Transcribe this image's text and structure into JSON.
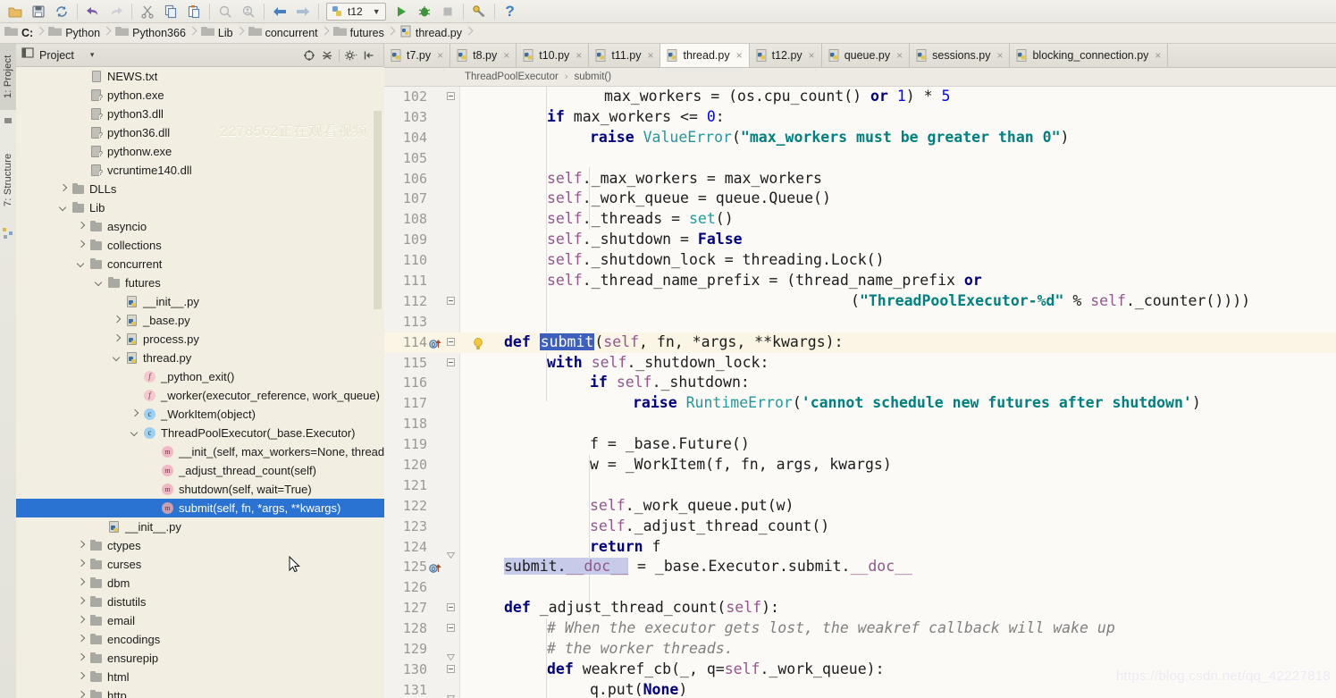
{
  "toolbar": {
    "buttons": [
      {
        "name": "open-folder-icon",
        "glyph": "folder"
      },
      {
        "name": "save-all-icon",
        "glyph": "save"
      },
      {
        "name": "sync-icon",
        "glyph": "sync"
      },
      {
        "name": "undo-icon",
        "glyph": "undo"
      },
      {
        "name": "redo-icon",
        "glyph": "redo"
      },
      {
        "name": "cut-icon",
        "glyph": "cut"
      },
      {
        "name": "copy-icon",
        "glyph": "copy"
      },
      {
        "name": "paste-icon",
        "glyph": "paste"
      },
      {
        "name": "find-icon",
        "glyph": "find"
      },
      {
        "name": "replace-icon",
        "glyph": "replace"
      },
      {
        "name": "back-icon",
        "glyph": "back"
      },
      {
        "name": "forward-icon",
        "glyph": "forward"
      }
    ],
    "run_config": {
      "label": "t12",
      "chevron": "▼"
    },
    "run_label": "Run",
    "debug_label": "Debug",
    "stop_label": "Stop",
    "tools_label": "Tools",
    "help_label": "?"
  },
  "pathbar": {
    "crumbs": [
      {
        "label": "C:",
        "icon": "folder-icon"
      },
      {
        "label": "Python",
        "icon": "folder-icon"
      },
      {
        "label": "Python366",
        "icon": "folder-icon"
      },
      {
        "label": "Lib",
        "icon": "folder-icon"
      },
      {
        "label": "concurrent",
        "icon": "folder-icon"
      },
      {
        "label": "futures",
        "icon": "folder-icon"
      },
      {
        "label": "thread.py",
        "icon": "python-file-icon"
      }
    ]
  },
  "rail": {
    "project_label": "1: Project",
    "structure_label": "7: Structure"
  },
  "project_panel": {
    "title": "Project",
    "dropdown_caret": "▾",
    "header_icons": [
      {
        "name": "locate-icon"
      },
      {
        "name": "collapse-all-icon"
      },
      {
        "name": "settings-icon"
      },
      {
        "name": "hide-panel-icon"
      }
    ],
    "watermark": "2278562正在观看视频",
    "tree": [
      {
        "label": "NEWS.txt",
        "indent": 3,
        "arrow": "none",
        "icon": "txt",
        "sel": false
      },
      {
        "label": "python.exe",
        "indent": 3,
        "arrow": "none",
        "icon": "dll",
        "sel": false
      },
      {
        "label": "python3.dll",
        "indent": 3,
        "arrow": "none",
        "icon": "dll",
        "sel": false
      },
      {
        "label": "python36.dll",
        "indent": 3,
        "arrow": "none",
        "icon": "dll",
        "sel": false
      },
      {
        "label": "pythonw.exe",
        "indent": 3,
        "arrow": "none",
        "icon": "dll",
        "sel": false
      },
      {
        "label": "vcruntime140.dll",
        "indent": 3,
        "arrow": "none",
        "icon": "dll",
        "sel": false
      },
      {
        "label": "DLLs",
        "indent": 2,
        "arrow": "closed",
        "icon": "folder",
        "sel": false
      },
      {
        "label": "Lib",
        "indent": 2,
        "arrow": "open",
        "icon": "folder",
        "sel": false
      },
      {
        "label": "asyncio",
        "indent": 3,
        "arrow": "closed",
        "icon": "folder",
        "sel": false
      },
      {
        "label": "collections",
        "indent": 3,
        "arrow": "closed",
        "icon": "folder",
        "sel": false
      },
      {
        "label": "concurrent",
        "indent": 3,
        "arrow": "open",
        "icon": "folder",
        "sel": false
      },
      {
        "label": "futures",
        "indent": 4,
        "arrow": "open",
        "icon": "folder",
        "sel": false
      },
      {
        "label": "__init__.py",
        "indent": 5,
        "arrow": "none",
        "icon": "py",
        "sel": false
      },
      {
        "label": "_base.py",
        "indent": 5,
        "arrow": "closed",
        "icon": "py",
        "sel": false
      },
      {
        "label": "process.py",
        "indent": 5,
        "arrow": "closed",
        "icon": "py",
        "sel": false
      },
      {
        "label": "thread.py",
        "indent": 5,
        "arrow": "open",
        "icon": "py",
        "sel": false
      },
      {
        "label": "_python_exit()",
        "indent": 6,
        "arrow": "none",
        "icon": "f",
        "sel": false
      },
      {
        "label": "_worker(executor_reference, work_queue)",
        "indent": 6,
        "arrow": "none",
        "icon": "f",
        "sel": false
      },
      {
        "label": "_WorkItem(object)",
        "indent": 6,
        "arrow": "closed",
        "icon": "c",
        "sel": false
      },
      {
        "label": "ThreadPoolExecutor(_base.Executor)",
        "indent": 6,
        "arrow": "open",
        "icon": "c",
        "sel": false
      },
      {
        "label": "__init_(self, max_workers=None, thread",
        "indent": 7,
        "arrow": "none",
        "icon": "m",
        "sel": false
      },
      {
        "label": "_adjust_thread_count(self)",
        "indent": 7,
        "arrow": "none",
        "icon": "m",
        "sel": false
      },
      {
        "label": "shutdown(self, wait=True)",
        "indent": 7,
        "arrow": "none",
        "icon": "m",
        "sel": false
      },
      {
        "label": "submit(self, fn, *args, **kwargs)",
        "indent": 7,
        "arrow": "none",
        "icon": "m",
        "sel": true
      },
      {
        "label": "__init__.py",
        "indent": 4,
        "arrow": "none",
        "icon": "py",
        "sel": false
      },
      {
        "label": "ctypes",
        "indent": 3,
        "arrow": "closed",
        "icon": "folder",
        "sel": false
      },
      {
        "label": "curses",
        "indent": 3,
        "arrow": "closed",
        "icon": "folder",
        "sel": false
      },
      {
        "label": "dbm",
        "indent": 3,
        "arrow": "closed",
        "icon": "folder",
        "sel": false
      },
      {
        "label": "distutils",
        "indent": 3,
        "arrow": "closed",
        "icon": "folder",
        "sel": false
      },
      {
        "label": "email",
        "indent": 3,
        "arrow": "closed",
        "icon": "folder",
        "sel": false
      },
      {
        "label": "encodings",
        "indent": 3,
        "arrow": "closed",
        "icon": "folder",
        "sel": false
      },
      {
        "label": "ensurepip",
        "indent": 3,
        "arrow": "closed",
        "icon": "folder",
        "sel": false
      },
      {
        "label": "html",
        "indent": 3,
        "arrow": "closed",
        "icon": "folder",
        "sel": false
      },
      {
        "label": "http",
        "indent": 3,
        "arrow": "closed",
        "icon": "folder",
        "sel": false
      }
    ]
  },
  "editor": {
    "tabs": [
      {
        "label": "t7.py",
        "active": false,
        "close": "×"
      },
      {
        "label": "t8.py",
        "active": false,
        "close": "×"
      },
      {
        "label": "t10.py",
        "active": false,
        "close": "×"
      },
      {
        "label": "t11.py",
        "active": false,
        "close": "×"
      },
      {
        "label": "thread.py",
        "active": true,
        "close": "×"
      },
      {
        "label": "t12.py",
        "active": false,
        "close": "×"
      },
      {
        "label": "queue.py",
        "active": false,
        "close": "×"
      },
      {
        "label": "sessions.py",
        "active": false,
        "close": "×"
      },
      {
        "label": "blocking_connection.py",
        "active": false,
        "close": "×"
      }
    ],
    "breadcrumb": {
      "class": "ThreadPoolExecutor",
      "sep": "›",
      "member": "submit()"
    },
    "watermark": "https://blog.csdn.net/qq_42227818",
    "first_line": 102,
    "lines": [
      {
        "n": 102,
        "html": "<span class=\"code\" style=\"left:246px\">max_workers = (os.cpu_count() <span class=\"kw\">or</span> <span class=\"num\">1</span>) * <span class=\"num\">5</span></span>",
        "fold": "mid",
        "hl": false
      },
      {
        "n": 103,
        "html": "<span class=\"code\" style=\"left:182px\"><span class=\"kw\">if</span> max_workers &lt;= <span class=\"num\">0</span>:</span>",
        "fold": "none",
        "hl": false
      },
      {
        "n": 104,
        "html": "<span class=\"code\" style=\"left:230px\"><span class=\"kw\">raise</span> <span class=\"cls\">ValueError</span>(<span class=\"str\">\"max_workers must be greater than 0\"</span>)</span>",
        "fold": "none",
        "hl": false
      },
      {
        "n": 105,
        "html": "",
        "fold": "none",
        "hl": false
      },
      {
        "n": 106,
        "html": "<span class=\"code\" style=\"left:182px\"><span class=\"slf\">self</span>._max_workers = max_workers</span>",
        "fold": "none",
        "hl": false
      },
      {
        "n": 107,
        "html": "<span class=\"code\" style=\"left:182px\"><span class=\"slf\">self</span>._work_queue = queue.Queue()</span>",
        "fold": "none",
        "hl": false
      },
      {
        "n": 108,
        "html": "<span class=\"code\" style=\"left:182px\"><span class=\"slf\">self</span>._threads = <span class=\"cls\">set</span>()</span>",
        "fold": "none",
        "hl": false
      },
      {
        "n": 109,
        "html": "<span class=\"code\" style=\"left:182px\"><span class=\"slf\">self</span>._shutdown = <span class=\"kw\">False</span></span>",
        "fold": "none",
        "hl": false
      },
      {
        "n": 110,
        "html": "<span class=\"code\" style=\"left:182px\"><span class=\"slf\">self</span>._shutdown_lock = threading.Lock()</span>",
        "fold": "none",
        "hl": false
      },
      {
        "n": 111,
        "html": "<span class=\"code\" style=\"left:182px\"><span class=\"slf\">self</span>._thread_name_prefix = (thread_name_prefix <span class=\"kw\">or</span></span>",
        "fold": "none",
        "hl": false
      },
      {
        "n": 112,
        "html": "<span class=\"code\" style=\"left:522px\">(<span class=\"str\">\"ThreadPoolExecutor-%d\"</span> % <span class=\"slf\">self</span>._counter())))</span>",
        "fold": "mid",
        "hl": false
      },
      {
        "n": 113,
        "html": "",
        "fold": "none",
        "hl": false
      },
      {
        "n": 114,
        "html": "<span class=\"code\" style=\"left:134px\"><span class=\"kw\">def</span> <span class=\"selword\">submit</span>(<span class=\"slf\">self</span>, fn, *args, **kwargs):</span>",
        "fold": "start",
        "hl": true,
        "gutter": "bookmark",
        "bulb": true
      },
      {
        "n": 115,
        "html": "<span class=\"code\" style=\"left:182px\"><span class=\"kw\">with</span> <span class=\"slf\">self</span>._shutdown_lock:</span>",
        "fold": "mid",
        "hl": false
      },
      {
        "n": 116,
        "html": "<span class=\"code\" style=\"left:230px\"><span class=\"kw\">if</span> <span class=\"slf\">self</span>._shutdown:</span>",
        "fold": "none",
        "hl": false
      },
      {
        "n": 117,
        "html": "<span class=\"code\" style=\"left:278px\"><span class=\"kw\">raise</span> <span class=\"cls\">RuntimeError</span>(<span class=\"str\">'cannot schedule new futures after shutdown'</span>)</span>",
        "fold": "none",
        "hl": false
      },
      {
        "n": 118,
        "html": "",
        "fold": "none",
        "hl": false
      },
      {
        "n": 119,
        "html": "<span class=\"code\" style=\"left:230px\">f = _base.Future()</span>",
        "fold": "none",
        "hl": false
      },
      {
        "n": 120,
        "html": "<span class=\"code\" style=\"left:230px\">w = _WorkItem(f, fn, args, kwargs)</span>",
        "fold": "none",
        "hl": false
      },
      {
        "n": 121,
        "html": "",
        "fold": "none",
        "hl": false
      },
      {
        "n": 122,
        "html": "<span class=\"code\" style=\"left:230px\"><span class=\"slf\">self</span>._work_queue.put(w)</span>",
        "fold": "none",
        "hl": false
      },
      {
        "n": 123,
        "html": "<span class=\"code\" style=\"left:230px\"><span class=\"slf\">self</span>._adjust_thread_count()</span>",
        "fold": "none",
        "hl": false
      },
      {
        "n": 124,
        "html": "<span class=\"code\" style=\"left:230px\"><span class=\"kw\">return</span> f</span>",
        "fold": "end",
        "hl": false
      },
      {
        "n": 125,
        "html": "<span class=\"code\" style=\"left:134px\"><span class=\"selbox\">submit.</span><span class=\"dunder selbox\">__doc__</span> = _base.Executor.submit.<span class=\"dunder\">__doc__</span></span>",
        "fold": "none",
        "hl": false,
        "gutter": "bookmark"
      },
      {
        "n": 126,
        "html": "",
        "fold": "none",
        "hl": false
      },
      {
        "n": 127,
        "html": "<span class=\"code\" style=\"left:134px\"><span class=\"kw\">def</span> _adjust_thread_count(<span class=\"slf\">self</span>):</span>",
        "fold": "start",
        "hl": false
      },
      {
        "n": 128,
        "html": "<span class=\"code\" style=\"left:182px\"><span class=\"cmt\"># When the executor gets lost, the weakref callback will wake up</span></span>",
        "fold": "mid",
        "hl": false
      },
      {
        "n": 129,
        "html": "<span class=\"code\" style=\"left:182px\"><span class=\"cmt\"># the worker threads.</span></span>",
        "fold": "end",
        "hl": false
      },
      {
        "n": 130,
        "html": "<span class=\"code\" style=\"left:182px\"><span class=\"kw\">def</span> weakref_cb(_, q=<span class=\"slf\">self</span>._work_queue):</span>",
        "fold": "start",
        "hl": false
      },
      {
        "n": 131,
        "html": "<span class=\"code\" style=\"left:230px\">q.put(<span class=\"kw\">None</span>)</span>",
        "fold": "end",
        "hl": false
      }
    ]
  }
}
